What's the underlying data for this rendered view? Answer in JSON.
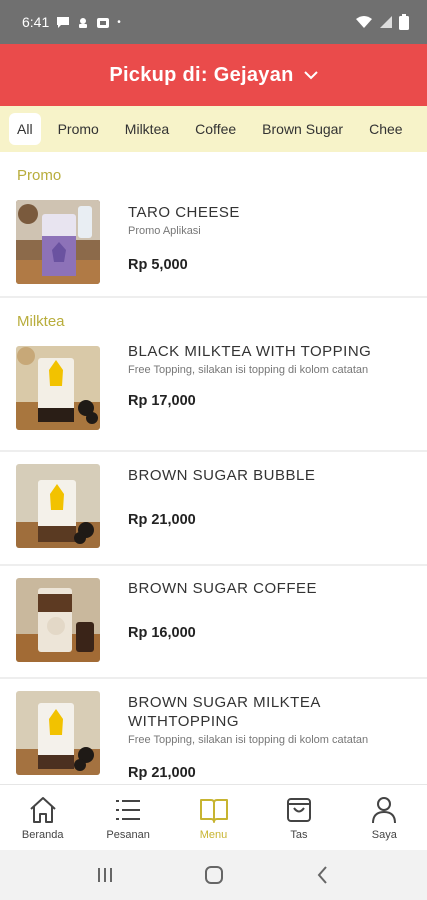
{
  "status_bar": {
    "time": "6:41",
    "dot": "•"
  },
  "header": {
    "title": "Pickup di: Gejayan"
  },
  "tabs": [
    {
      "label": "All"
    },
    {
      "label": "Promo"
    },
    {
      "label": "Milktea"
    },
    {
      "label": "Coffee"
    },
    {
      "label": "Brown Sugar"
    },
    {
      "label": "Chee"
    }
  ],
  "sections": {
    "promo": {
      "title": "Promo",
      "items": [
        {
          "name": "TARO CHEESE",
          "desc": "Promo Aplikasi",
          "price": "Rp 5,000"
        }
      ]
    },
    "milktea": {
      "title": "Milktea",
      "items": [
        {
          "name": "BLACK MILKTEA WITH TOPPING",
          "desc": "Free Topping, silakan isi topping di kolom catatan",
          "price": "Rp 17,000"
        },
        {
          "name": "BROWN SUGAR BUBBLE",
          "desc": "",
          "price": "Rp 21,000"
        },
        {
          "name": "BROWN SUGAR COFFEE",
          "desc": "",
          "price": "Rp 16,000"
        },
        {
          "name": "BROWN SUGAR MILKTEA WITHTOPPING",
          "desc": "Free Topping, silakan isi topping di kolom catatan",
          "price": "Rp 21,000"
        }
      ]
    }
  },
  "bottom_nav": [
    {
      "label": "Beranda",
      "icon": "home-icon"
    },
    {
      "label": "Pesanan",
      "icon": "list-icon"
    },
    {
      "label": "Menu",
      "icon": "book-icon",
      "active": true
    },
    {
      "label": "Tas",
      "icon": "bag-icon"
    },
    {
      "label": "Saya",
      "icon": "user-icon"
    }
  ],
  "colors": {
    "header": "#ea4b4b",
    "tabs_bg": "#f7f3c9",
    "accent": "#c7b431",
    "section_title": "#b8ad3c"
  }
}
